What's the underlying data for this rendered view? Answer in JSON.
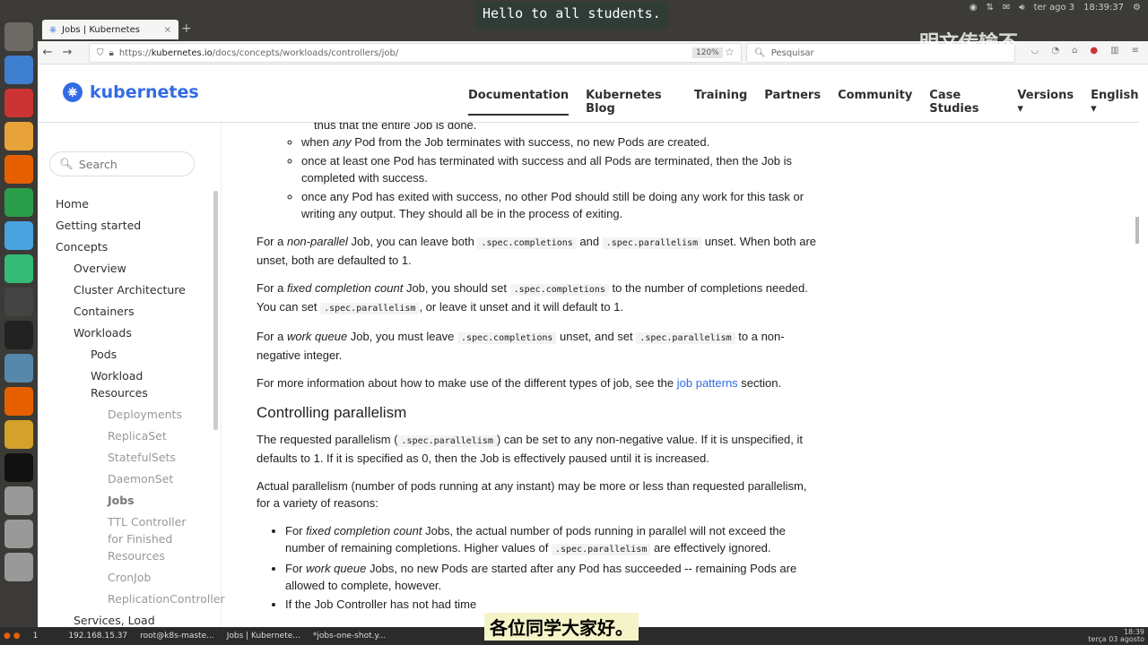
{
  "captions": {
    "top": "Hello to all students.",
    "bottom": "各位同学大家好。",
    "watermark": "明文传输不"
  },
  "panel": {
    "date": "ter ago 3",
    "time": "18:39:37"
  },
  "browser": {
    "tab_title": "Jobs | Kubernetes",
    "url_prefix": "https://",
    "url_host": "kubernetes.io",
    "url_path": "/docs/concepts/workloads/controllers/job/",
    "zoom": "120%",
    "search_placeholder": "Pesquisar"
  },
  "site": {
    "logo": "kubernetes",
    "nav": [
      "Documentation",
      "Kubernetes Blog",
      "Training",
      "Partners",
      "Community",
      "Case Studies",
      "Versions ▾",
      "English ▾"
    ]
  },
  "sidebar": {
    "search_placeholder": "Search",
    "items": [
      "Home",
      "Getting started",
      "Concepts",
      "Overview",
      "Cluster Architecture",
      "Containers",
      "Workloads",
      "Pods",
      "Workload",
      "Resources",
      "Deployments",
      "ReplicaSet",
      "StatefulSets",
      "DaemonSet",
      "Jobs",
      "TTL Controller",
      "for Finished",
      "Resources",
      "CronJob",
      "ReplicationController",
      "Services, Load"
    ]
  },
  "content": {
    "top_line": "thus that the entire Job is done.",
    "b1a": "when ",
    "b1em": "any",
    "b1b": " Pod from the Job terminates with success, no new Pods are created.",
    "b2": "once at least one Pod has terminated with success and all Pods are terminated, then the Job is completed with success.",
    "b3": "once any Pod has exited with success, no other Pod should still be doing any work for this task or writing any output. They should all be in the process of exiting.",
    "p1a": "For a ",
    "p1em": "non-parallel",
    "p1b": " Job, you can leave both ",
    "c_comp": ".spec.completions",
    "and": " and ",
    "c_par": ".spec.parallelism",
    "p1c": " unset. When both are unset, both are defaulted to 1.",
    "p2a": "For a ",
    "p2em": "fixed completion count",
    "p2b": " Job, you should set ",
    "p2c": " to the number of completions needed. You can set ",
    "p2d": ", or leave it unset and it will default to 1.",
    "p3a": "For a ",
    "p3em": "work queue",
    "p3b": " Job, you must leave ",
    "p3c": " unset, and set ",
    "p3d": " to a non-negative integer.",
    "p4a": "For more information about how to make use of the different types of job, see the ",
    "p4link": "job patterns",
    "p4b": " section.",
    "h2": "Controlling parallelism",
    "p5a": "The requested parallelism (",
    "p5b": ") can be set to any non-negative value. If it is unspecified, it defaults to 1. If it is specified as 0, then the Job is effectively paused until it is increased.",
    "p6": "Actual parallelism (number of pods running at any instant) may be more or less than requested parallelism, for a variety of reasons:",
    "d1a": "For ",
    "d1em": "fixed completion count",
    "d1b": " Jobs, the actual number of pods running in parallel will not exceed the number of remaining completions. Higher values of ",
    "d1c": " are effectively ignored.",
    "d2a": "For ",
    "d2em": "work queue",
    "d2b": " Jobs, no new Pods are started after any Pod has succeeded -- remaining Pods are allowed to complete, however.",
    "d3": "If the Job Controller has not had time"
  },
  "taskbar": {
    "workspace": "1",
    "items": [
      "192.168.15.37",
      "root@k8s-maste...",
      "Jobs | Kubernete...",
      "*jobs-one-shot.y..."
    ],
    "time": "18:39",
    "date": "terça 03 agosto"
  }
}
